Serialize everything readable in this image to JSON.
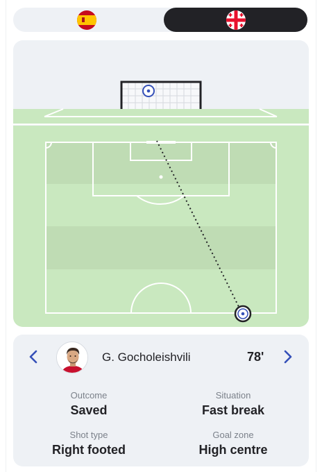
{
  "teams": [
    {
      "name": "Spain",
      "flag_icon": "spain-flag-icon",
      "active": false
    },
    {
      "name": "Georgia",
      "flag_icon": "georgia-flag-icon",
      "active": true
    }
  ],
  "shot": {
    "player_name": "G. Gocholeishvili",
    "minute": "78'",
    "stats": [
      {
        "label": "Outcome",
        "value": "Saved"
      },
      {
        "label": "Situation",
        "value": "Fast break"
      },
      {
        "label": "Shot type",
        "value": "Right footed"
      },
      {
        "label": "Goal zone",
        "value": "High centre"
      }
    ]
  },
  "colors": {
    "pitch_green": "#c9e8bf",
    "pitch_green_dark": "#bfdcb4",
    "accent_blue": "#3550b8",
    "dark": "#222226",
    "card_bg": "#eef1f5"
  }
}
